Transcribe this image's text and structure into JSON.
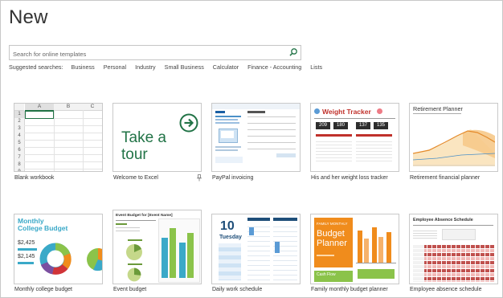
{
  "page": {
    "title": "New"
  },
  "search": {
    "placeholder": "Search for online templates",
    "icon": "search-icon"
  },
  "suggested": {
    "label": "Suggested searches:",
    "items": [
      "Business",
      "Personal",
      "Industry",
      "Small Business",
      "Calculator",
      "Finance - Accounting",
      "Lists"
    ]
  },
  "templates": [
    {
      "caption": "Blank workbook"
    },
    {
      "caption": "Welcome to Excel"
    },
    {
      "caption": "PayPal invoicing"
    },
    {
      "caption": "His and her weight loss tracker"
    },
    {
      "caption": "Retirement financial planner"
    },
    {
      "caption": "Monthly college budget"
    },
    {
      "caption": "Event budget"
    },
    {
      "caption": "Daily work schedule"
    },
    {
      "caption": "Family monthly budget planner"
    },
    {
      "caption": "Employee absence schedule"
    }
  ],
  "blank": {
    "columns": [
      "A",
      "B",
      "C"
    ],
    "rows": [
      "1",
      "2",
      "3",
      "4",
      "5",
      "6",
      "7",
      "8",
      "9"
    ]
  },
  "tour": {
    "line1": "Take a",
    "line2": "tour"
  },
  "weight": {
    "title": "Weight Tracker",
    "nums": [
      "209",
      "180",
      "137",
      "135"
    ]
  },
  "retirement": {
    "title": "Retirement Planner"
  },
  "college": {
    "title_line1": "Monthly",
    "title_line2": "College Budget",
    "amount1": "$2,425",
    "amount2": "$2,145"
  },
  "event": {
    "title": "Event Budget for [Event Name]"
  },
  "schedule": {
    "day_num": "10",
    "day_name": "Tuesday"
  },
  "family": {
    "label": "FAMILY MONTHLY",
    "title_line1": "Budget",
    "title_line2": "Planner",
    "cash_flow": "Cash Flow"
  },
  "absence": {
    "title": "Employee Absence Schedule"
  },
  "colors": {
    "excel_green": "#217346",
    "orange": "#f08c1c",
    "teal": "#3aa9c8",
    "red": "#d13438"
  }
}
